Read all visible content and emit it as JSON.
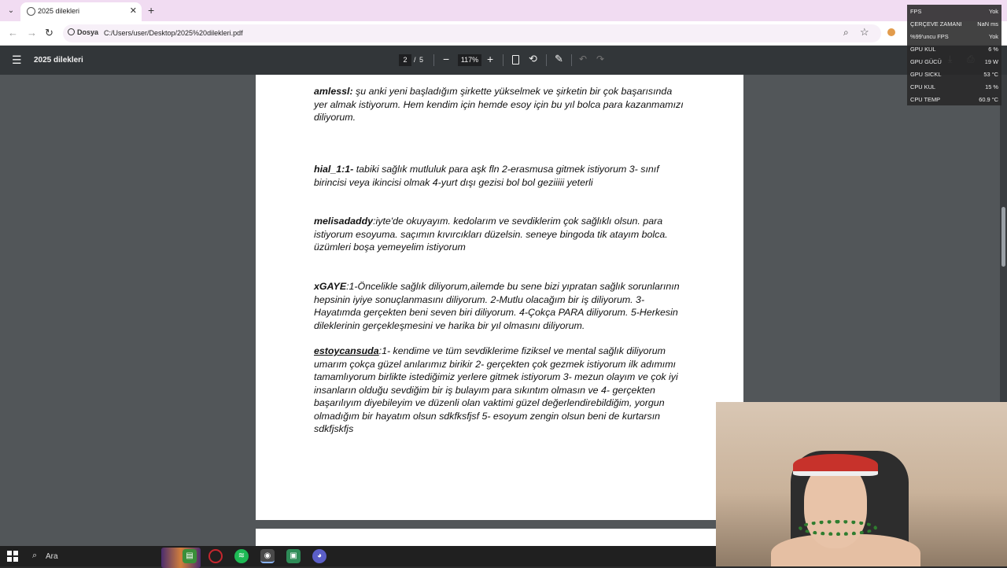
{
  "browser": {
    "tab_title": "2025 dilekleri",
    "tab_close": "✕",
    "new_tab": "+",
    "site_label": "Dosya",
    "url": "C:/Users/user/Desktop/2025%20dilekleri.pdf"
  },
  "pdf_toolbar": {
    "title": "2025 dilekleri",
    "current_page": "2",
    "page_separator": "/",
    "total_pages": "5",
    "zoom": "117%"
  },
  "entries": [
    {
      "user": "amlessl:",
      "underline": false,
      "text": " şu anki yeni başladığım şirkette yükselmek ve şirketin bir çok başarısında yer almak istiyorum. Hem kendim için hemde esoy için bu yıl bolca para kazanmamızı diliyorum."
    },
    {
      "user": "hial_1:1-",
      "underline": false,
      "text": " tabiki sağlık mutluluk para aşk fln 2-erasmusa gitmek istiyorum 3- sınıf birincisi veya ikincisi olmak 4-yurt dışı gezisi bol bol geziiiii yeterli"
    },
    {
      "user": "melisadaddy",
      "underline": false,
      "text": ":iyte'de okuyayım. kedolarım ve sevdiklerim çok sağlıklı olsun. para istiyorum esoyuma. saçımın kıvırcıkları düzelsin. seneye bingoda tik atayım bolca. üzümleri boşa yemeyelim istiyorum"
    },
    {
      "user": "xGAYE",
      "underline": false,
      "text": ":1-Öncelikle sağlık diliyorum,ailemde bu sene bizi yıpratan sağlık sorunlarının hepsinin iyiye sonuçlanmasını diliyorum. 2-Mutlu olacağım bir iş diliyorum. 3-Hayatımda gerçekten beni seven biri diliyorum. 4-Çokça PARA diliyorum. 5-Herkesin dileklerinin gerçekleşmesini ve harika bir yıl olmasını diliyorum."
    },
    {
      "user": "estoycansuda",
      "underline": true,
      "text": ":1- kendime ve tüm sevdiklerime fiziksel ve mental sağlık diliyorum umarım çokça güzel anılarımız birikir 2- gerçekten çok gezmek istiyorum ilk adımımı tamamlıyorum birlikte istediğimiz yerlere gitmek istiyorum 3- mezun olayım ve çok iyi insanların olduğu sevdiğim bir iş bulayım para sıkıntım olmasın ve 4- gerçekten başarılıyım diyebileyim ve düzenli olan vaktimi güzel değerlendirebildiğim, yorgun olmadığım bir hayatım olsun sdkfksfjsf 5- esoyum zengin olsun beni de kurtarsın sdkfjskfjs"
    }
  ],
  "taskbar": {
    "search_text": "Ara"
  },
  "perf_overlay": [
    {
      "key": "FPS",
      "value": "Yok"
    },
    {
      "key": "ÇERÇEVE ZAMANI",
      "value": "NaN ms"
    },
    {
      "key": "%99'uncu FPS",
      "value": "Yok"
    },
    {
      "key": "GPU KUL",
      "value": "6 %"
    },
    {
      "key": "GPU GÜCÜ",
      "value": "19 W"
    },
    {
      "key": "GPU SICKL",
      "value": "53 °C"
    },
    {
      "key": "CPU KUL",
      "value": "15 %"
    },
    {
      "key": "CPU TEMP",
      "value": "60.9 °C"
    }
  ],
  "colors": {
    "tab_strip": "#f1dcf2",
    "pdf_toolbar": "#323639",
    "viewer_bg": "#525659",
    "taskbar": "#202020"
  }
}
